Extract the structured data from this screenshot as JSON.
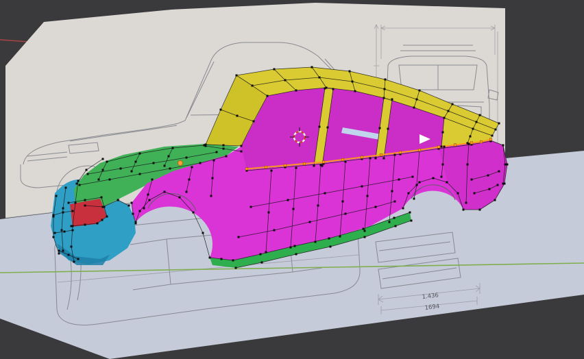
{
  "app": {
    "name": "3D viewport (mesh edit mode)",
    "description": "Car body polygon mesh being modeled over blueprint reference planes"
  },
  "blueprint": {
    "dim_upper": "1.436",
    "dim_lower": "1694"
  },
  "colors": {
    "background": "#3a3a3c",
    "plane_vertical": "#dcd9d4",
    "plane_ground": "#c6cbd9",
    "blueprint_line": "#84868e",
    "blueprint_line_dark": "#5e6066",
    "fold_line": "#b7b8c0",
    "axis_green": "#7fae4f",
    "axis_red": "#a84444",
    "body_magenta": "#da33d6",
    "body_magenta_far": "#cb2ec6",
    "body_magenta_dark": "#c02bbc",
    "hood_green": "#41b158",
    "sill_green": "#2fae4e",
    "roof_yellow": "#d9cb31",
    "windshield_yellow": "#cfc128",
    "pillar_yellow": "#d9cb31",
    "bumper_cyan": "#2f9fc6",
    "bumper_cyan_dark": "#1d7fa8",
    "accent_red": "#c8303e",
    "glass_cyan": "#bfe8ee",
    "wire": "#141414",
    "vertex": "#0d0d0d",
    "selection_orange": "#ff9a1e",
    "cursor_red": "#cc3333",
    "cursor_white": "#f2f2f2",
    "origin_orange": "#ff9f40",
    "active_white": "#ffffff"
  }
}
